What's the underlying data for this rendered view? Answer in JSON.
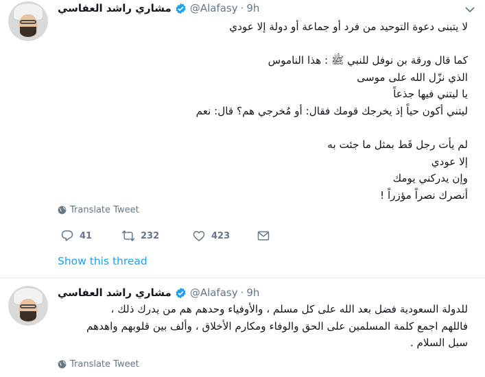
{
  "colors": {
    "accent": "#1da1f2",
    "muted": "#657786",
    "text": "#14171a"
  },
  "tweets": [
    {
      "author_name": "مشاري راشد العفاسي",
      "handle": "@Alafasy",
      "separator": "·",
      "time": "9h",
      "lines": [
        "لا يتبنى دعوة التوحيد من فرد أو جماعة أو دولة إلا عودي",
        "",
        "كما قال ورقة بن نوفل للنبي ﷺ : هذا الناموس",
        "الذي نزّل الله على موسى",
        "يا ليتني فيها جذعاً",
        "ليتني أكون حياً إذ يخرجك قومك فقال: أو مُخرجي هم؟ قال: نعم",
        "",
        "لم يأت رجل قَط بمثل ما جئت به",
        "إلا عودي",
        "وإن يدركني يومك",
        "أنصرك نصراً مؤزراً !"
      ],
      "translate_label": "Translate Tweet",
      "reply_count": "41",
      "retweet_count": "232",
      "like_count": "423",
      "show_thread": "Show this thread"
    },
    {
      "author_name": "مشاري راشد العفاسي",
      "handle": "@Alafasy",
      "separator": "·",
      "time": "9h",
      "lines": [
        "للدولة السعودية فضل بعد الله على كل مسلم ، والأوفياء وحدهم هم من يدرك ذلك ،",
        "فاللهم اجمع كلمة المسلمين على الحق والوفاء ومكارم الأخلاق ، وألف بين قلوبهم واهدهم",
        "سبل السلام ."
      ],
      "translate_label": "Translate Tweet"
    }
  ],
  "icons": [
    "verified-badge-icon",
    "caret-down-icon",
    "globe-icon",
    "reply-icon",
    "retweet-icon",
    "like-icon",
    "direct-message-icon"
  ]
}
